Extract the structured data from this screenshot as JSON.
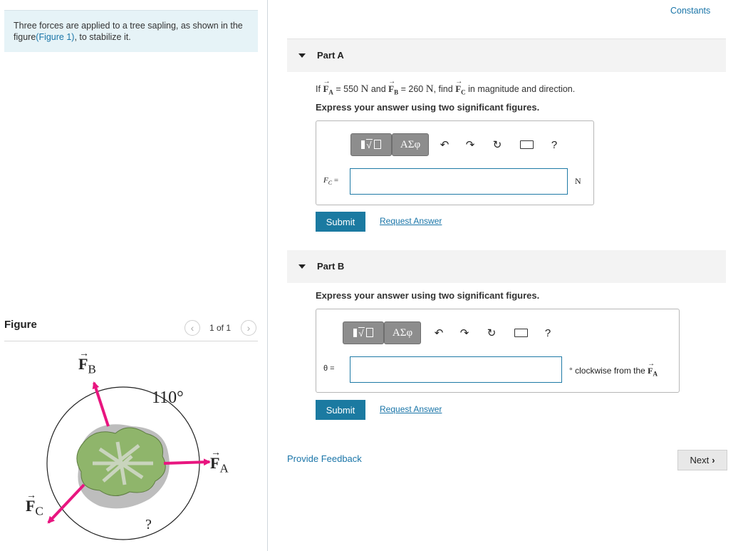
{
  "intro": {
    "text_before": "Three forces are applied to a tree sapling, as shown in the figure",
    "figure_link": "(Figure 1)",
    "text_after": ", to stabilize it."
  },
  "header": {
    "constants_link": "Constants"
  },
  "part_a": {
    "title": "Part A",
    "q_if": "If",
    "fa_letter": "F",
    "fa_sub": "A",
    "fa_value": "= 550",
    "unit_n": "N",
    "q_and": "and",
    "fb_letter": "F",
    "fb_sub": "B",
    "fb_value": "= 260",
    "q_find": ", find",
    "fc_letter": "F",
    "fc_sub": "C",
    "q_tail": "in magnitude and direction.",
    "express": "Express your answer using two significant figures.",
    "label_f": "F",
    "label_sub": "C",
    "label_eq": "=",
    "input_value": "",
    "unit": "N",
    "submit": "Submit",
    "request": "Request Answer"
  },
  "part_b": {
    "title": "Part B",
    "express": "Express your answer using two significant figures.",
    "label": "θ =",
    "input_value": "",
    "unit_pre": "° clockwise from the",
    "unit_vec": "F",
    "unit_sub": "A",
    "submit": "Submit",
    "request": "Request Answer"
  },
  "toolbar": {
    "templates_icon": "sqrt-template-icon",
    "greek_label": "ΑΣφ",
    "undo_icon": "undo-icon",
    "redo_icon": "redo-icon",
    "reset_icon": "reset-icon",
    "keyboard_icon": "keyboard-icon",
    "help_label": "?"
  },
  "footer": {
    "feedback": "Provide Feedback",
    "next": "Next"
  },
  "figure": {
    "title": "Figure",
    "pager": "1 of 1",
    "label_fb": "F",
    "label_fb_sub": "B",
    "label_fa": "F",
    "label_fa_sub": "A",
    "label_fc": "F",
    "label_fc_sub": "C",
    "angle_label": "110°",
    "unknown_label": "?"
  },
  "colors": {
    "accent": "#1b7aa1",
    "arrow": "#e8157f",
    "link": "#1a75a8",
    "intro_bg": "#e6f3f7"
  }
}
